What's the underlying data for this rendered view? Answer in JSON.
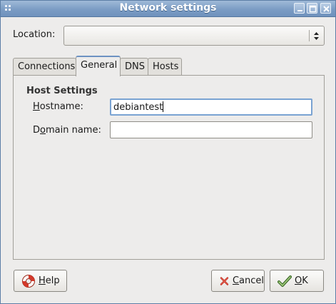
{
  "window": {
    "title": "Network settings"
  },
  "location": {
    "label": "Location:",
    "value": ""
  },
  "tabs": [
    {
      "label": "Connections",
      "active": false
    },
    {
      "label": "General",
      "active": true
    },
    {
      "label": "DNS",
      "active": false
    },
    {
      "label": "Hosts",
      "active": false
    }
  ],
  "general": {
    "section_title": "Host Settings",
    "hostname": {
      "label_mnemonic": "H",
      "label_rest": "ostname:",
      "value": "debiantest"
    },
    "domain": {
      "label_pre": "D",
      "label_mnemonic": "o",
      "label_rest": "main name:",
      "value": ""
    }
  },
  "buttons": {
    "help": {
      "mnemonic": "H",
      "rest": "elp",
      "icon": "lifebuoy-icon"
    },
    "cancel": {
      "mnemonic": "C",
      "rest": "ancel",
      "icon": "x-icon"
    },
    "ok": {
      "mnemonic": "O",
      "rest": "K",
      "icon": "checkmark-icon"
    }
  },
  "colors": {
    "titlebar": "#7b9cc4",
    "focus": "#7aa3d2",
    "tab_highlight": "#6d92c2"
  }
}
